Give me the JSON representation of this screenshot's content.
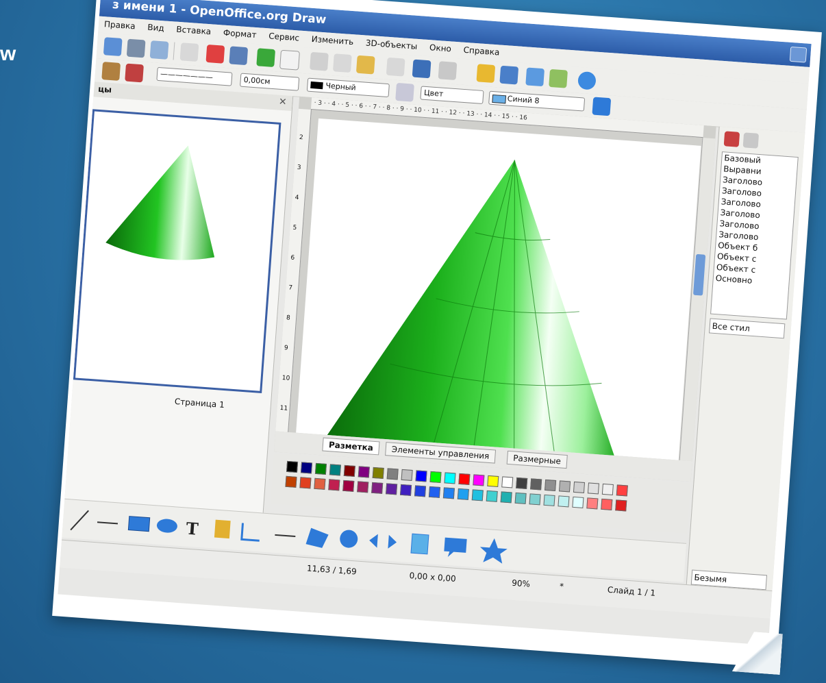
{
  "slide_fragment": "w",
  "window": {
    "title": "з имени 1 - OpenOffice.org Draw"
  },
  "menu": [
    "Правка",
    "Вид",
    "Вставка",
    "Формат",
    "Сервис",
    "Изменить",
    "3D-объекты",
    "Окно",
    "Справка"
  ],
  "toolbar": {
    "line_width": "0,00см",
    "line_color": "Черный",
    "area_style": "Цвет",
    "area_color": "Синий 8"
  },
  "left_panel": {
    "title": "цы",
    "page_label": "Страница 1"
  },
  "ruler_h": "· 3 · · 4 · · 5 · · 6 · · 7 · · 8 · · 9 · · 10 · · 11 · · 12 · · 13 · · 14 · · 15 · · 16",
  "ruler_v": [
    "2",
    "3",
    "4",
    "5",
    "6",
    "7",
    "8",
    "9",
    "10",
    "11"
  ],
  "tabs": [
    "Разметка",
    "Элементы управления",
    "Размерные"
  ],
  "styles": {
    "items": [
      "Базовый",
      "Выравни",
      "Заголово",
      "Заголово",
      "Заголово",
      "Заголово",
      "Заголово",
      "Заголово",
      "Объект б",
      "Объект с",
      "Объект с",
      "Основно"
    ],
    "filter": "Все стил",
    "bottom": "Безымя"
  },
  "status": {
    "position": "11,63 / 1,69",
    "size": "0,00 x 0,00",
    "zoom": "90%",
    "modified": "*",
    "slide": "Слайд 1 / 1"
  },
  "colors": {
    "accent": "#3b5fa5",
    "cone": "#1fc21f"
  }
}
